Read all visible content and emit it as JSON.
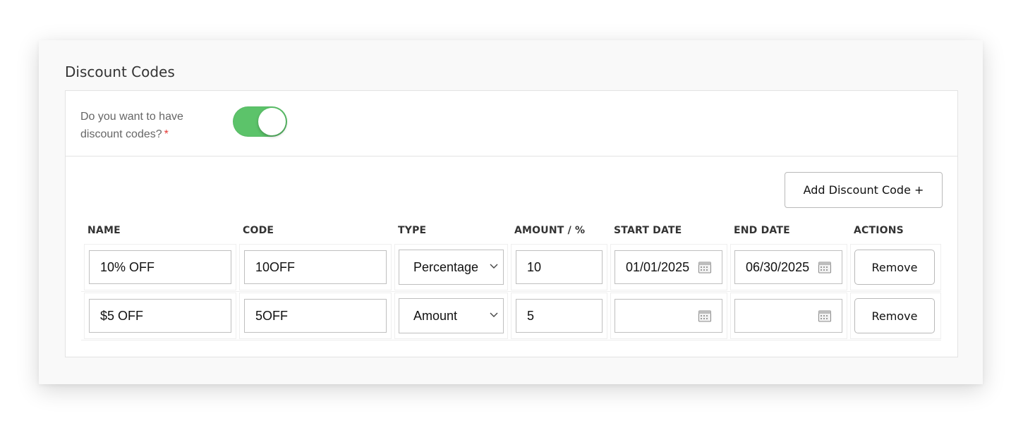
{
  "section": {
    "title": "Discount Codes"
  },
  "toggle": {
    "question": "Do you want to have discount codes?",
    "required_mark": "*",
    "enabled": true,
    "on_color": "#5cc36a"
  },
  "add_button": {
    "label": "Add Discount Code +"
  },
  "table": {
    "columns": [
      "NAME",
      "CODE",
      "TYPE",
      "AMOUNT / %",
      "START DATE",
      "END DATE",
      "ACTIONS"
    ],
    "rows": [
      {
        "name": "10% OFF",
        "code": "10OFF",
        "type": "Percentage",
        "amount": "10",
        "start_date": "01/01/2025",
        "end_date": "06/30/2025",
        "action": "Remove"
      },
      {
        "name": "$5 OFF",
        "code": "5OFF",
        "type": "Amount",
        "amount": "5",
        "start_date": "",
        "end_date": "",
        "action": "Remove"
      }
    ]
  },
  "icons": {
    "date_field": "calendar-icon",
    "select": "chevron-down-icon"
  }
}
